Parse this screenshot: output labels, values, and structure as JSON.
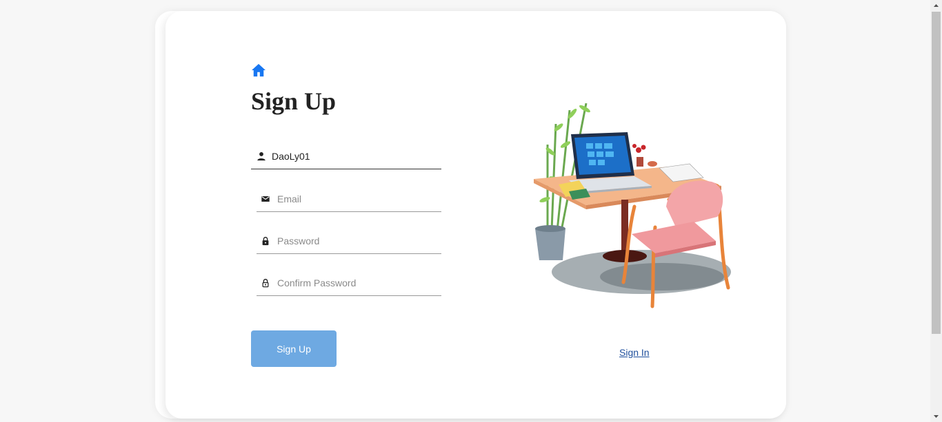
{
  "form": {
    "title": "Sign Up",
    "username": {
      "value": "DaoLy01",
      "icon": "person-icon"
    },
    "email": {
      "placeholder": "Email",
      "icon": "mail-icon"
    },
    "password": {
      "placeholder": "Password",
      "icon": "lock-icon"
    },
    "confirm_password": {
      "placeholder": "Confirm Password",
      "icon": "lock-outline-icon"
    },
    "submit_label": "Sign Up"
  },
  "nav": {
    "home_icon": "home-icon",
    "signin_label": "Sign In"
  },
  "colors": {
    "accent": "#1877f2",
    "button": "#6ea9e2",
    "link": "#1e4e9c"
  }
}
